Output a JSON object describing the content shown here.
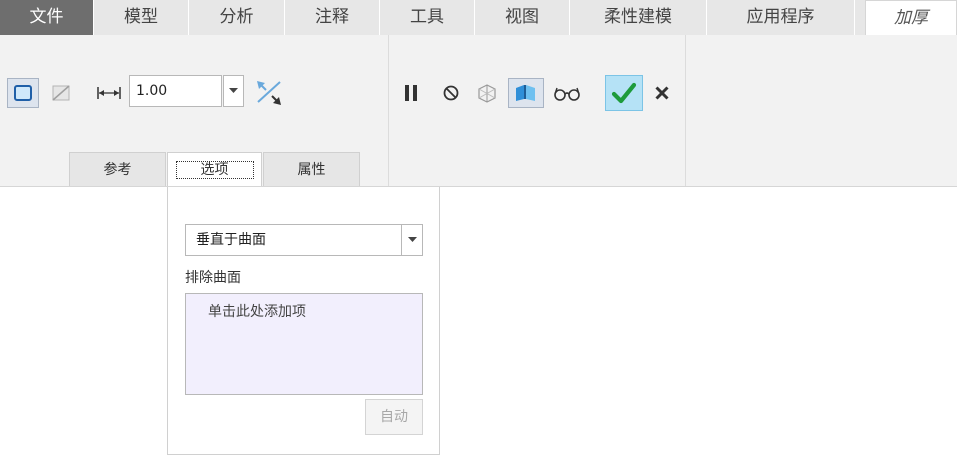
{
  "menu": {
    "tabs": [
      {
        "label": "文件"
      },
      {
        "label": "模型"
      },
      {
        "label": "分析"
      },
      {
        "label": "注释"
      },
      {
        "label": "工具"
      },
      {
        "label": "视图"
      },
      {
        "label": "柔性建模"
      },
      {
        "label": "应用程序"
      },
      {
        "label": "加厚"
      }
    ]
  },
  "ribbon": {
    "thickness_value": "1.00",
    "icons": [
      "solid-thicken-icon",
      "surface-trim-icon",
      "thickness-dimension-icon",
      "flip-direction-icon",
      "pause-icon",
      "no-preview-icon",
      "geometry-preview-icon",
      "verify-preview-icon",
      "glasses-preview-icon",
      "confirm-check-icon",
      "cancel-x-icon"
    ],
    "subtabs": [
      {
        "label": "参考"
      },
      {
        "label": "选项"
      },
      {
        "label": "属性"
      }
    ]
  },
  "options_panel": {
    "method_selected": "垂直于曲面",
    "exclude_label": "排除曲面",
    "collector_placeholder": "单击此处添加项",
    "auto_button": "自动"
  },
  "colors": {
    "file_tab_bg": "#6e6e6e",
    "ribbon_bg": "#f2f2f2",
    "check_green": "#1e9b3c",
    "confirm_bg": "#b5e2f6",
    "collector_bg": "#f2effd"
  }
}
